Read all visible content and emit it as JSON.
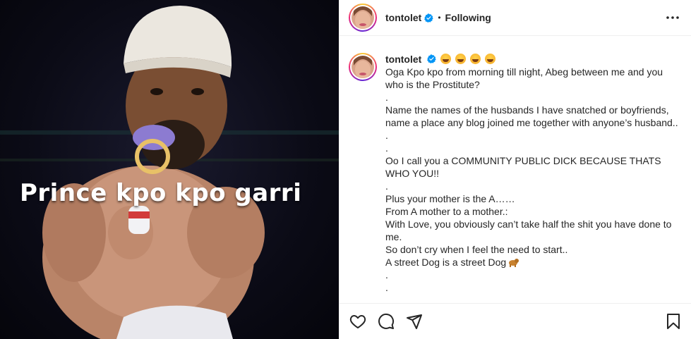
{
  "post": {
    "username": "tontolet",
    "separator": "•",
    "follow_status": "Following",
    "media_caption": "Prince kpo kpo garri",
    "caption_username": "tontolet",
    "caption_lines": [
      "Oga Kpo kpo from morning till night, Abeg between me and you who is the Prostitute?",
      ".",
      "Name the names of the husbands I have snatched or boyfriends, name a place any blog joined me together with anyone’s husband..",
      ".",
      ".",
      "Oo I call you a COMMUNITY PUBLIC DICK BECAUSE THATS WHO YOU!!",
      ".",
      "Plus your mother is the A……",
      "From A mother to a mother.:",
      "With Love, you obviously can’t take half the shit you have done to me.",
      "So don’t cry when I feel the need to start..",
      "A street Dog is a street Dog",
      ".",
      "."
    ]
  },
  "icons": {
    "verified": "verified-badge-icon",
    "more": "more-options-icon",
    "like": "heart-icon",
    "comment": "comment-icon",
    "share": "send-icon",
    "save": "bookmark-icon"
  },
  "colors": {
    "verified_blue": "#0095f6",
    "text": "#262626",
    "divider": "#efefef"
  }
}
